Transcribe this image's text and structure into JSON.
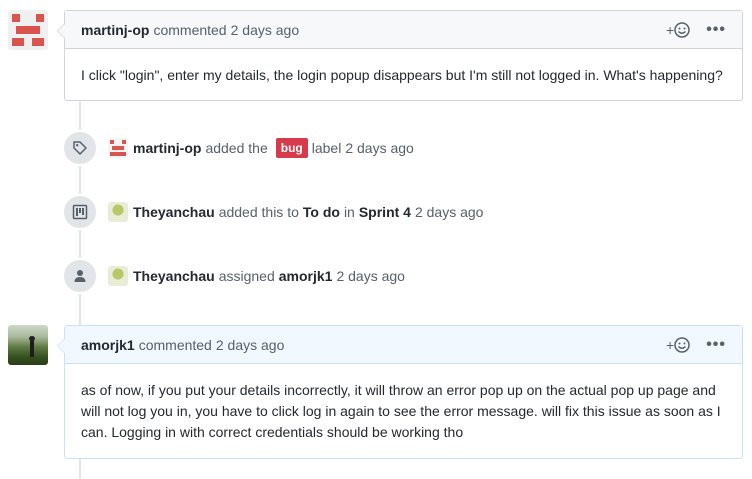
{
  "comments": [
    {
      "author": "martinj-op",
      "action": "commented",
      "time": "2 days ago",
      "reaction_label": "+",
      "more_label": "•••",
      "body": "I click \"login\", enter my details, the login popup disappears but I'm still not logged in. What's happening?"
    },
    {
      "author": "amorjk1",
      "action": "commented",
      "time": "2 days ago",
      "reaction_label": "+",
      "more_label": "•••",
      "body": "as of now, if you put your details incorrectly, it will throw an error pop up on the actual pop up page and will not log you in, you have to click log in again to see the error message. will fix this issue as soon as I can. Logging in with correct credentials should be working tho"
    }
  ],
  "events": [
    {
      "icon": "tag-icon",
      "actor": "martinj-op",
      "text_1": "added the",
      "label": "bug",
      "text_2": "label",
      "time": "2 days ago"
    },
    {
      "icon": "project-icon",
      "actor": "Theyanchau",
      "text_1": "added this to",
      "column": "To do",
      "text_2": "in",
      "project": "Sprint 4",
      "time": "2 days ago"
    },
    {
      "icon": "person-icon",
      "actor": "Theyanchau",
      "text_1": "assigned",
      "assignee": "amorjk1",
      "time": "2 days ago"
    }
  ],
  "colors": {
    "bug_label": "#d73a4a",
    "identicon": "#d9534f",
    "blue_header": "#f1f8ff"
  }
}
